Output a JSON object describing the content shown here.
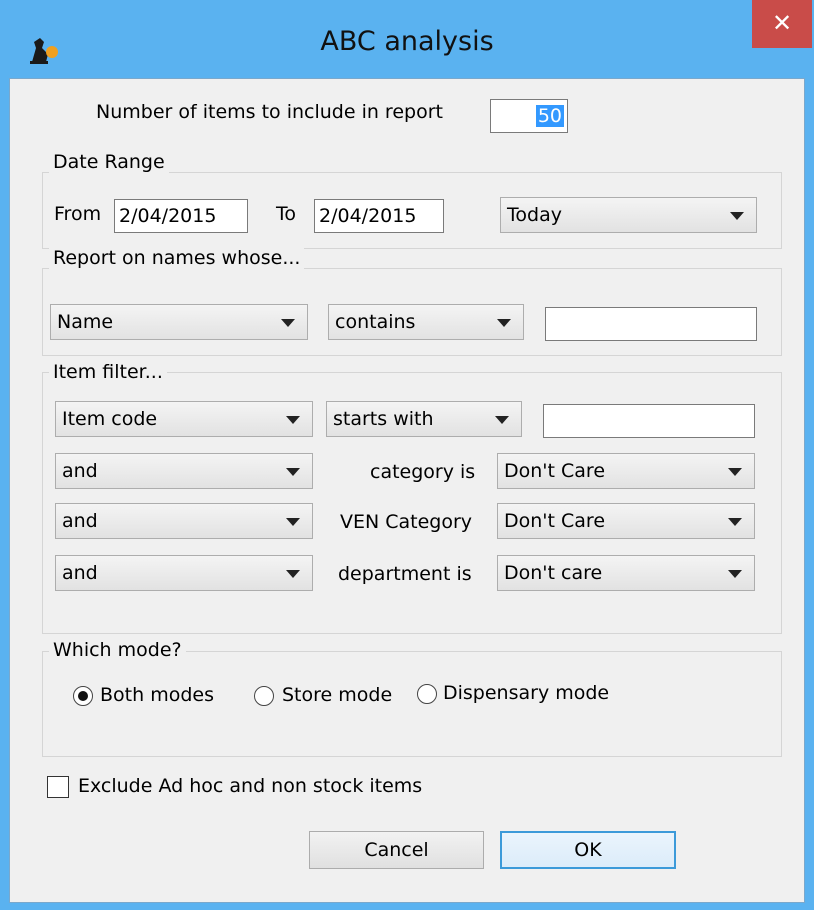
{
  "window": {
    "title": "ABC analysis",
    "close_label": "✕"
  },
  "items_count": {
    "label": "Number of items to include in report",
    "value": "50"
  },
  "date_range": {
    "title": "Date Range",
    "from_label": "From",
    "from_value": "2/04/2015",
    "to_label": "To",
    "to_value": "2/04/2015",
    "preset": "Today"
  },
  "names_filter": {
    "title": "Report on names whose...",
    "field": "Name",
    "operator": "contains",
    "value": ""
  },
  "item_filter": {
    "title": "Item filter...",
    "field": "Item code",
    "operator": "starts with",
    "value": "",
    "rows": [
      {
        "conj": "and",
        "label": "category is",
        "value": "Don't Care"
      },
      {
        "conj": "and",
        "label": "VEN Category",
        "value": "Don't Care"
      },
      {
        "conj": "and",
        "label": "department is",
        "value": "Don't care"
      }
    ]
  },
  "mode": {
    "title": "Which mode?",
    "options": [
      "Both modes",
      "Store mode",
      "Dispensary mode"
    ],
    "selected": "Both modes"
  },
  "exclude": {
    "label": "Exclude Ad hoc and non stock items",
    "checked": false
  },
  "buttons": {
    "cancel": "Cancel",
    "ok": "OK"
  }
}
